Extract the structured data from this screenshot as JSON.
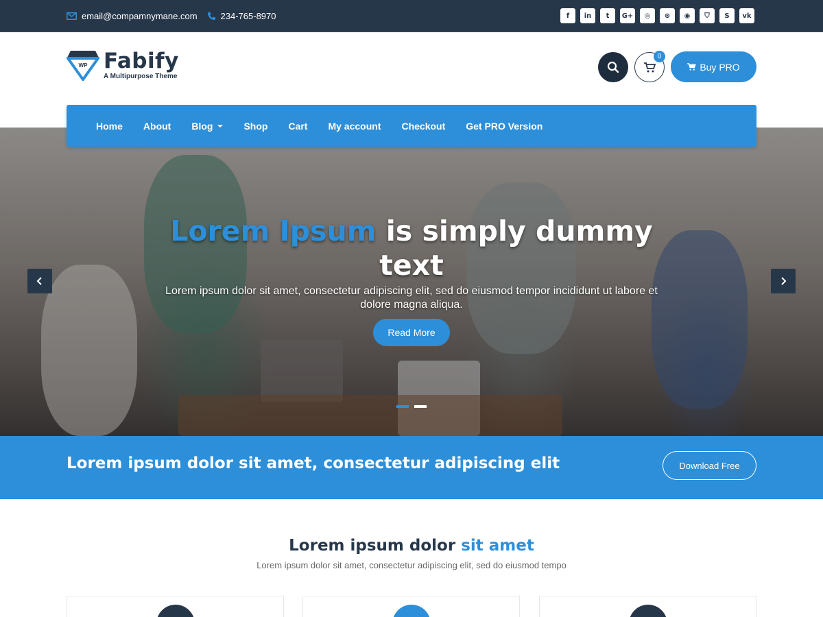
{
  "topbar": {
    "email": "email@compamnymane.com",
    "phone": "234-765-8970",
    "socials": [
      {
        "icon": "facebook-icon",
        "glyph": "f"
      },
      {
        "icon": "linkedin-icon",
        "glyph": "in"
      },
      {
        "icon": "twitter-icon",
        "glyph": "t"
      },
      {
        "icon": "google-plus-icon",
        "glyph": "G+"
      },
      {
        "icon": "instagram-icon",
        "glyph": "◎"
      },
      {
        "icon": "dribbble-icon",
        "glyph": "⊛"
      },
      {
        "icon": "github-icon",
        "glyph": "◉"
      },
      {
        "icon": "bitbucket-icon",
        "glyph": "⛉"
      },
      {
        "icon": "skype-icon",
        "glyph": "S"
      },
      {
        "icon": "vk-icon",
        "glyph": "vk"
      }
    ]
  },
  "header": {
    "logo_title": "Fabify",
    "logo_tagline": "A Multipurpose Theme",
    "logo_badge": "WP",
    "cart_count": "0",
    "buy_label": "Buy PRO"
  },
  "nav": {
    "items": [
      {
        "label": "Home"
      },
      {
        "label": "About"
      },
      {
        "label": "Blog"
      },
      {
        "label": "Shop"
      },
      {
        "label": "Cart"
      },
      {
        "label": "My account"
      },
      {
        "label": "Checkout"
      },
      {
        "label": "Get PRO Version"
      }
    ]
  },
  "hero": {
    "title_accent": "Lorem Ipsum",
    "title_rest": " is simply dummy text",
    "subtitle": "Lorem ipsum dolor sit amet, consectetur adipiscing elit, sed do eiusmod tempor incididunt ut labore et dolore magna aliqua.",
    "button": "Read More"
  },
  "cta": {
    "text": "Lorem ipsum dolor sit amet, consectetur adipiscing elit",
    "button": "Download Free"
  },
  "section": {
    "title_main": "Lorem ipsum dolor ",
    "title_accent": "sit amet",
    "subtitle": "Lorem ipsum dolor sit amet, consectetur adipiscing elit, sed do eiusmod tempo"
  },
  "colors": {
    "primary": "#2d8fd9",
    "dark": "#27374a"
  }
}
